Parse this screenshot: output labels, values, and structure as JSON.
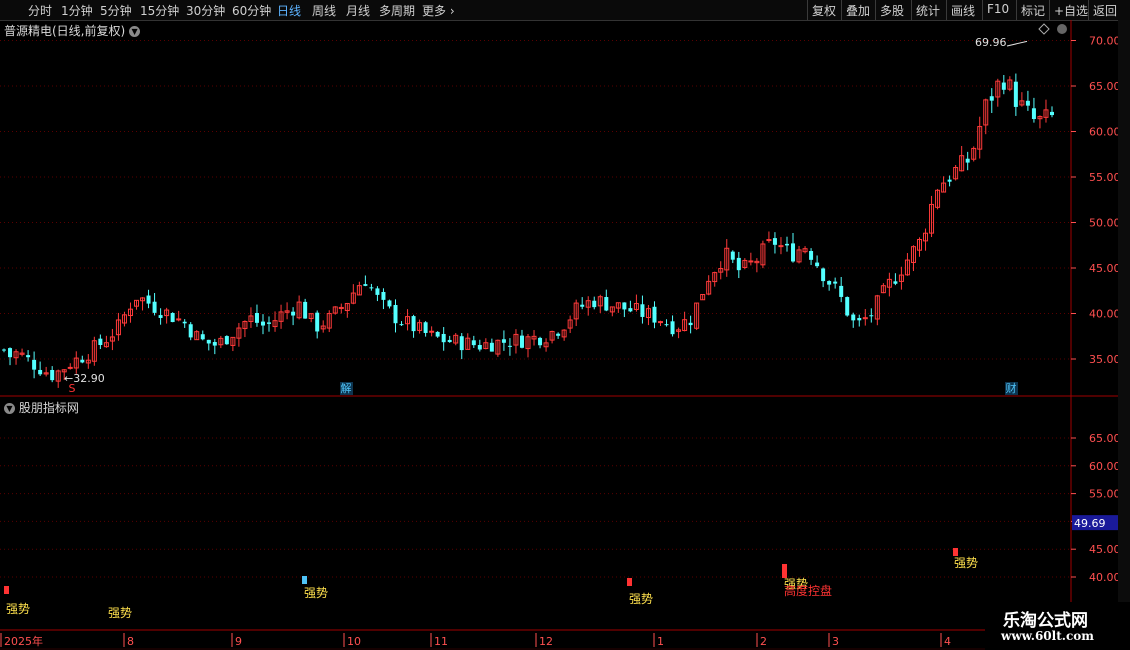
{
  "toolbar": {
    "periods": [
      "分时",
      "1分钟",
      "5分钟",
      "15分钟",
      "30分钟",
      "60分钟",
      "日线",
      "周线",
      "月线",
      "多周期",
      "更多"
    ],
    "active_period": "日线",
    "more_arrow": "›",
    "actions": [
      "复权",
      "叠加",
      "多股",
      "统计",
      "画线",
      "F10",
      "标记",
      "+自选",
      "返回"
    ]
  },
  "main_panel": {
    "title": "普源精电(日线,前复权)",
    "collapse_icon": "chevron-down-icon",
    "high_label": "69.96",
    "low_label": "32.90",
    "events": [
      {
        "label": "S",
        "color": "#ff3333"
      },
      {
        "label": "解",
        "color": "#4fc3f7"
      },
      {
        "label": "财",
        "color": "#4fc3f7"
      }
    ],
    "axis_ticks": [
      "70.00",
      "65.00",
      "60.00",
      "55.00",
      "50.00",
      "45.00",
      "40.00",
      "35.00"
    ]
  },
  "sub_panel": {
    "title": "股朋指标网",
    "axis_ticks": [
      "65.00",
      "60.00",
      "55.00",
      "50.00",
      "45.00",
      "40.00"
    ],
    "current_value": "49.69",
    "signals": [
      {
        "label": "强势",
        "color": "#ffe14d",
        "bar": "#ff3333"
      },
      {
        "label": "强势",
        "color": "#ffe14d",
        "bar": ""
      },
      {
        "label": "强势",
        "color": "#ffe14d",
        "bar": "#4fc3f7"
      },
      {
        "label": "强势",
        "color": "#ffe14d",
        "bar": "#ff3333"
      },
      {
        "label": "强势",
        "color": "#ffe14d",
        "bar": "#ff3333"
      },
      {
        "label": "强势",
        "color": "#ffe14d",
        "bar": "#ff3333"
      }
    ],
    "extra_label": "高度控盘",
    "extra_label_color": "#ff3333"
  },
  "date_axis": [
    "2025年",
    "8",
    "9",
    "10",
    "11",
    "12",
    "1",
    "2",
    "3",
    "4"
  ],
  "watermark": {
    "line1": "乐淘公式网",
    "line2": "www.60lt.com"
  },
  "colors": {
    "up": "#ff3a3a",
    "down": "#54ffff",
    "grid": "#5a0000",
    "border": "#a00000",
    "axis_text": "#ff5050"
  },
  "chart_data": {
    "type": "candlestick",
    "title": "普源精电(日线,前复权)",
    "ylim": [
      31,
      72
    ],
    "y_ticks": [
      35,
      40,
      45,
      50,
      55,
      60,
      65,
      70
    ],
    "x_labels": [
      "2025年",
      "8",
      "9",
      "10",
      "11",
      "12",
      "1",
      "2",
      "3",
      "4"
    ],
    "high": 69.96,
    "low": 32.9,
    "close_path": [
      36.0,
      35.5,
      34.2,
      33.2,
      34.5,
      35.5,
      36.8,
      38.5,
      42.0,
      41.0,
      40.0,
      39.0,
      37.0,
      36.5,
      38.0,
      39.5,
      38.5,
      40.0,
      41.0,
      38.5,
      39.5,
      41.5,
      44.0,
      41.0,
      39.5,
      38.5,
      37.5,
      37.0,
      36.8,
      36.5,
      36.8,
      37.0,
      37.2,
      37.5,
      38.5,
      40.5,
      41.5,
      41.0,
      40.5,
      40.0,
      39.5,
      38.5,
      39.5,
      44.0,
      46.5,
      44.5,
      46.0,
      48.0,
      46.5,
      47.5,
      44.5,
      42.0,
      38.5,
      40.0,
      43.0,
      45.5,
      48.0,
      54.0,
      55.5,
      57.0,
      63.0,
      66.0,
      63.0,
      61.0,
      61.5
    ],
    "sub_indicator_value": 49.69
  }
}
